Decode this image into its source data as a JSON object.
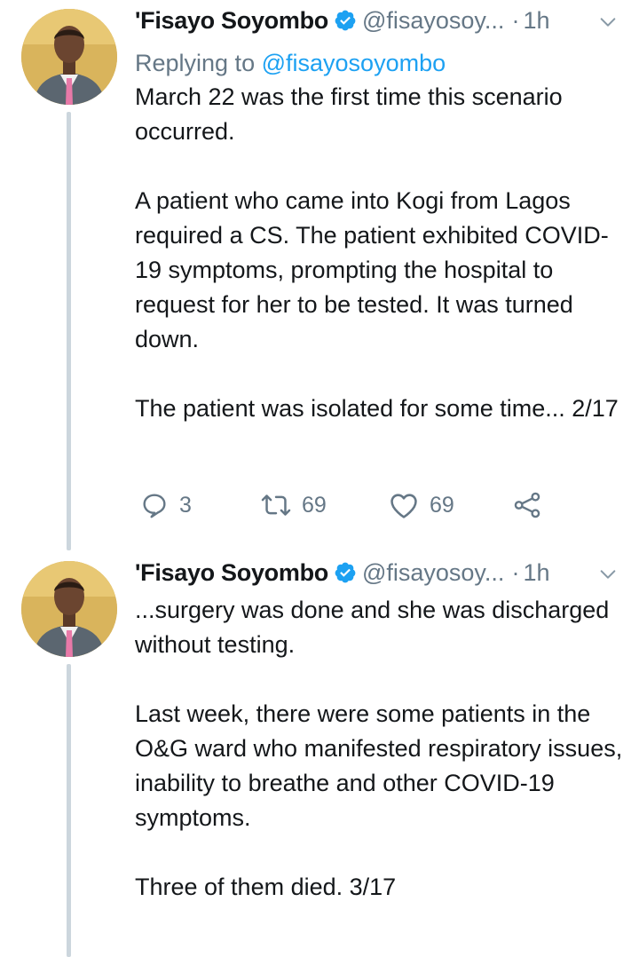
{
  "tweets": [
    {
      "author": {
        "display_name": "'Fisayo Soyombo",
        "handle": "@fisayosoy...",
        "verified_icon": "verified-badge-icon",
        "avatar": "avatar-photo"
      },
      "separator": "·",
      "time": "1h",
      "replying_to_label": "Replying to",
      "replying_to_handle": "@fisayosoyombo",
      "paragraphs": [
        "March 22 was the first time this scenario occurred.",
        "A patient who came into Kogi from Lagos required a CS. The patient exhibited COVID-19 symptoms, prompting the hospital to request for her to be tested. It was turned down.",
        "The patient was isolated for some time... 2/17"
      ],
      "actions": {
        "reply_count": "3",
        "retweet_count": "69",
        "like_count": "69"
      }
    },
    {
      "author": {
        "display_name": "'Fisayo Soyombo",
        "handle": "@fisayosoy...",
        "verified_icon": "verified-badge-icon",
        "avatar": "avatar-photo"
      },
      "separator": "·",
      "time": "1h",
      "paragraphs": [
        "...surgery was done and she was discharged without testing.",
        "Last week, there were some patients in the O&G ward who manifested respiratory issues, inability to breathe and other COVID-19 symptoms.",
        "Three of them died. 3/17"
      ]
    }
  ],
  "colors": {
    "accent": "#1da1f2",
    "secondary_text": "#657786",
    "primary_text": "#14171a",
    "thread_line": "#ccd6dd"
  }
}
